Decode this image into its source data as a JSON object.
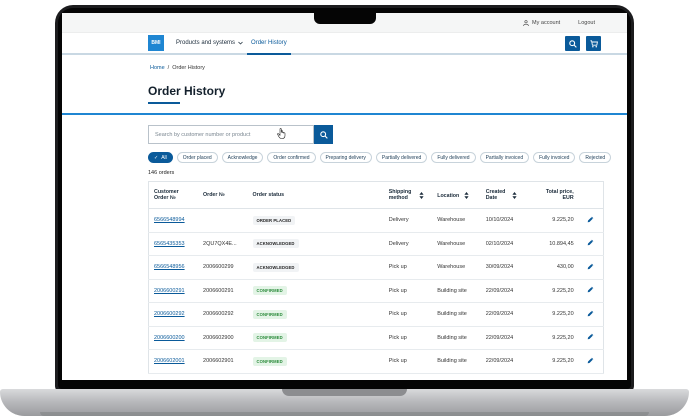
{
  "utility": {
    "my_account": "My account",
    "logout": "Logout"
  },
  "nav": {
    "logo": "BMI",
    "products": "Products and systems",
    "order_history": "Order History"
  },
  "breadcrumb": {
    "home": "Home",
    "separator": "/",
    "current": "Order History"
  },
  "page": {
    "title": "Order History"
  },
  "search": {
    "placeholder": "Search by customer number or product"
  },
  "filters": [
    {
      "label": "All",
      "selected": true
    },
    {
      "label": "Order placed"
    },
    {
      "label": "Acknowledge"
    },
    {
      "label": "Order confirmed"
    },
    {
      "label": "Preparing delivery"
    },
    {
      "label": "Partially delivered"
    },
    {
      "label": "Fully delivered"
    },
    {
      "label": "Partially invoiced"
    },
    {
      "label": "Fully invoiced"
    },
    {
      "label": "Rejected"
    }
  ],
  "orders_count": "146 orders",
  "table": {
    "headers": {
      "customer_order": "Customer Order №",
      "order_no": "Order №",
      "status": "Order status",
      "shipping": "Shipping method",
      "location": "Location",
      "created": "Created Date",
      "total": "Total price, EUR"
    },
    "rows": [
      {
        "customer_order": "6566548994",
        "order_no": "",
        "status": "ORDER PLACED",
        "shipping": "Delivery",
        "location": "Warehouse",
        "created": "10/10/2024",
        "total": "9.225,20"
      },
      {
        "customer_order": "6565435353",
        "order_no": "2QU7QX4E...",
        "status": "ACKNOWLEDGED",
        "shipping": "Delivery",
        "location": "Warehouse",
        "created": "02/10/2024",
        "total": "10.894,45"
      },
      {
        "customer_order": "6566548956",
        "order_no": "2006600299",
        "status": "ACKNOWLEDGED",
        "shipping": "Pick up",
        "location": "Warehouse",
        "created": "30/09/2024",
        "total": "430,00"
      },
      {
        "customer_order": "2006600291",
        "order_no": "2006600291",
        "status": "CONFIRMED",
        "shipping": "Pick up",
        "location": "Building site",
        "created": "22/09/2024",
        "total": "9.225,20"
      },
      {
        "customer_order": "2006600292",
        "order_no": "2006600292",
        "status": "CONFIRMED",
        "shipping": "Pick up",
        "location": "Building site",
        "created": "22/09/2024",
        "total": "9.225,20"
      },
      {
        "customer_order": "2006600200",
        "order_no": "2006602900",
        "status": "CONFIRMED",
        "shipping": "Pick up",
        "location": "Building site",
        "created": "22/09/2024",
        "total": "9.225,20"
      },
      {
        "customer_order": "2006602001",
        "order_no": "2006602901",
        "status": "CONFIRMED",
        "shipping": "Pick up",
        "location": "Building site",
        "created": "22/09/2024",
        "total": "9.225,20"
      }
    ]
  },
  "colors": {
    "primary": "#0a5a9a",
    "accent": "#1f86d2",
    "confirmed_bg": "#e3f4e6",
    "confirmed_text": "#2a8a3a"
  }
}
